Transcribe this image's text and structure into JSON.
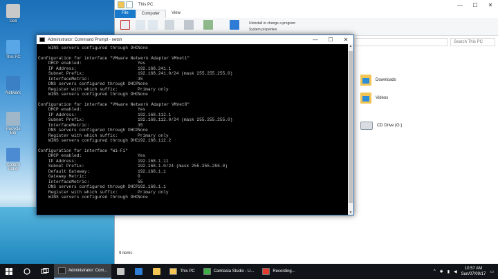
{
  "desktop_icons": [
    {
      "label": "Dell",
      "color": "#c9c9c9"
    },
    {
      "label": "This PC",
      "color": "#5aa7e8"
    },
    {
      "label": "Network",
      "color": "#3b7fc4"
    },
    {
      "label": "Recycle Bin",
      "color": "#9fb7c9"
    },
    {
      "label": "Control Panel",
      "color": "#4c8bd1"
    }
  ],
  "explorer": {
    "title": "This PC",
    "tabs": {
      "file": "File",
      "computer": "Computer",
      "view": "View"
    },
    "ribbon": {
      "uninstall": "Uninstall or change a program",
      "system_properties": "System properties",
      "labels": [
        "Properties",
        "Open",
        "Rename",
        "Access media",
        "Map network drive",
        "Add a network location",
        "Open Settings"
      ]
    },
    "search_placeholder": "Search This PC",
    "folders": [
      {
        "name": "Downloads"
      },
      {
        "name": "Videos"
      }
    ],
    "drive": {
      "name": "CD Drive (G:)"
    },
    "status": "9 items"
  },
  "cmd": {
    "title": "Administrator: Command Prompt - netsh",
    "controls": {
      "minimize": "—",
      "maximize": "☐",
      "close": "✕"
    },
    "lines": [
      {
        "type": "kv",
        "k": "    WINS servers configured through DHCP:",
        "v": "None"
      },
      {
        "type": "gap"
      },
      {
        "type": "hdr",
        "text": "Configuration for interface \"VMware Network Adapter VMnet1\""
      },
      {
        "type": "kv",
        "k": "    DHCP enabled:",
        "v": "Yes"
      },
      {
        "type": "kv",
        "k": "    IP Address:",
        "v": "192.168.241.1"
      },
      {
        "type": "kv",
        "k": "    Subnet Prefix:",
        "v": "192.168.241.0/24 (mask 255.255.255.0)"
      },
      {
        "type": "kv",
        "k": "    InterfaceMetric:",
        "v": "35"
      },
      {
        "type": "kv",
        "k": "    DNS servers configured through DHCP:",
        "v": "None"
      },
      {
        "type": "kv",
        "k": "    Register with which suffix:",
        "v": "Primary only"
      },
      {
        "type": "kv",
        "k": "    WINS servers configured through DHCP:",
        "v": "None"
      },
      {
        "type": "gap"
      },
      {
        "type": "hdr",
        "text": "Configuration for interface \"VMware Network Adapter VMnet8\""
      },
      {
        "type": "kv",
        "k": "    DHCP enabled:",
        "v": "Yes"
      },
      {
        "type": "kv",
        "k": "    IP Address:",
        "v": "192.168.112.1"
      },
      {
        "type": "kv",
        "k": "    Subnet Prefix:",
        "v": "192.168.112.0/24 (mask 255.255.255.0)"
      },
      {
        "type": "kv",
        "k": "    InterfaceMetric:",
        "v": "35"
      },
      {
        "type": "kv",
        "k": "    DNS servers configured through DHCP:",
        "v": "None"
      },
      {
        "type": "kv",
        "k": "    Register with which suffix:",
        "v": "Primary only"
      },
      {
        "type": "kv",
        "k": "    WINS servers configured through DHCP:",
        "v": "192.168.112.2"
      },
      {
        "type": "gap"
      },
      {
        "type": "hdr",
        "text": "Configuration for interface \"Wi-Fi\""
      },
      {
        "type": "kv",
        "k": "    DHCP enabled:",
        "v": "Yes"
      },
      {
        "type": "kv",
        "k": "    IP Address:",
        "v": "192.168.1.11"
      },
      {
        "type": "kv",
        "k": "    Subnet Prefix:",
        "v": "192.168.1.0/24 (mask 255.255.255.0)"
      },
      {
        "type": "kv",
        "k": "    Default Gateway:",
        "v": "192.168.1.1"
      },
      {
        "type": "kv",
        "k": "    Gateway Metric:",
        "v": "0"
      },
      {
        "type": "kv",
        "k": "    InterfaceMetric:",
        "v": "55"
      },
      {
        "type": "kv",
        "k": "    DNS servers configured through DHCP:",
        "v": "192.168.1.1"
      },
      {
        "type": "kv",
        "k": "    Register with which suffix:",
        "v": "Primary only"
      },
      {
        "type": "kv",
        "k": "    WINS servers configured through DHCP:",
        "v": "None"
      }
    ]
  },
  "taskbar": {
    "apps": [
      {
        "label": "Administrator: Com...",
        "color": "#222",
        "active": true
      },
      {
        "label": "This PC",
        "color": "#f2c555",
        "active": false
      },
      {
        "label": "Camtasia Studio - U...",
        "color": "#3fae49",
        "active": false
      },
      {
        "label": "Recording...",
        "color": "#e23b2e",
        "active": false
      }
    ],
    "time": "10:57 AM",
    "date": "Sun/07/09/17"
  }
}
